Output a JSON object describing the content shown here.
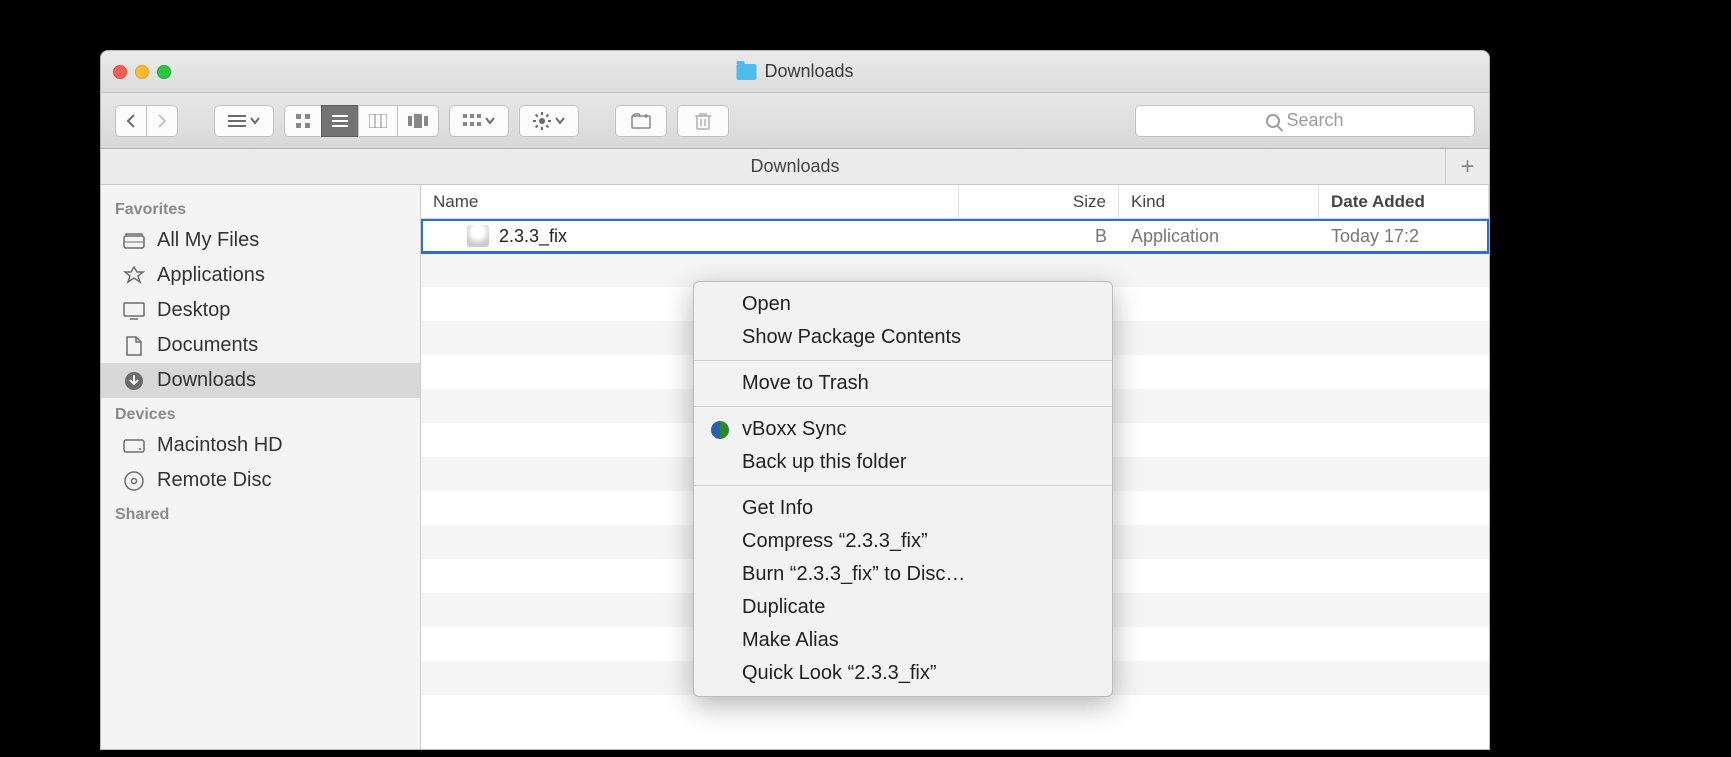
{
  "window": {
    "title": "Downloads"
  },
  "toolbar": {
    "search_placeholder": "Search"
  },
  "pathbar": {
    "location": "Downloads"
  },
  "sidebar": {
    "sections": [
      {
        "title": "Favorites",
        "items": [
          {
            "label": "All My Files",
            "icon": "all-my-files"
          },
          {
            "label": "Applications",
            "icon": "applications"
          },
          {
            "label": "Desktop",
            "icon": "desktop"
          },
          {
            "label": "Documents",
            "icon": "documents"
          },
          {
            "label": "Downloads",
            "icon": "downloads",
            "selected": true
          }
        ]
      },
      {
        "title": "Devices",
        "items": [
          {
            "label": "Macintosh HD",
            "icon": "hdd"
          },
          {
            "label": "Remote Disc",
            "icon": "disc"
          }
        ]
      },
      {
        "title": "Shared",
        "items": []
      }
    ]
  },
  "columns": {
    "name": "Name",
    "size": "Size",
    "kind": "Kind",
    "date": "Date Added"
  },
  "files": [
    {
      "name": "2.3.3_fix",
      "size_partial": "B",
      "kind": "Application",
      "date": "Today 17:2",
      "selected": true
    }
  ],
  "context_menu": {
    "items": [
      {
        "label": "Open"
      },
      {
        "label": "Show Package Contents"
      },
      {
        "sep": true
      },
      {
        "label": "Move to Trash"
      },
      {
        "sep": true
      },
      {
        "label": "vBoxx Sync",
        "icon": "sync"
      },
      {
        "label": "Back up this folder"
      },
      {
        "sep": true
      },
      {
        "label": "Get Info"
      },
      {
        "label": "Compress “2.3.3_fix”"
      },
      {
        "label": "Burn “2.3.3_fix” to Disc…"
      },
      {
        "label": "Duplicate"
      },
      {
        "label": "Make Alias"
      },
      {
        "label": "Quick Look “2.3.3_fix”"
      }
    ]
  }
}
